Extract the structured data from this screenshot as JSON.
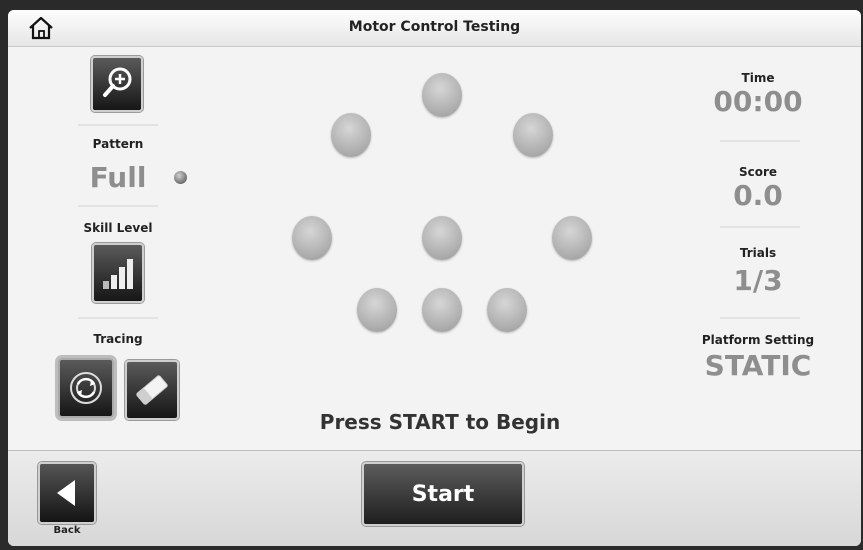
{
  "header": {
    "title": "Motor Control Testing",
    "home_icon": "home-icon"
  },
  "left_panel": {
    "zoom_icon": "zoom-in-icon",
    "pattern_label": "Pattern",
    "pattern_value": "Full",
    "skill_label": "Skill Level",
    "skill_icon": "signal-bars-icon",
    "tracing_label": "Tracing",
    "tracing_icon": "trace-target-icon",
    "eraser_icon": "eraser-icon"
  },
  "right_panel": {
    "time_label": "Time",
    "time_value": "00:00",
    "score_label": "Score",
    "score_value": "0.0",
    "trials_label": "Trials",
    "trials_value": "1/3",
    "platform_label": "Platform Setting",
    "platform_value": "STATIC"
  },
  "main": {
    "prompt": "Press START to Begin"
  },
  "footer": {
    "back_label": "Back",
    "start_label": "Start",
    "back_icon": "back-arrow-icon"
  }
}
